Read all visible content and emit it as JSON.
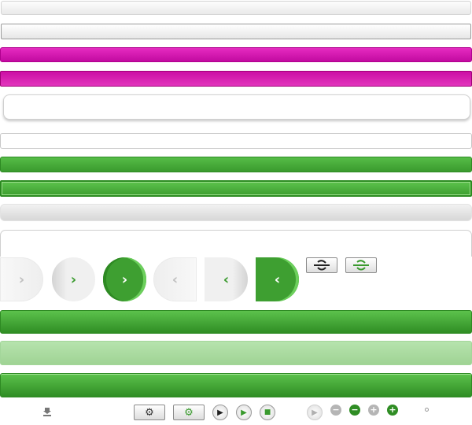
{
  "arrows": {
    "right": "›",
    "left": "‹"
  },
  "icons": {
    "gear": "⚙",
    "play": "▶",
    "stop": "■",
    "minus": "−",
    "plus": "+",
    "download": "download-icon",
    "link": "link-toggle-icon",
    "dot": "dot-icon"
  },
  "colors": {
    "magenta": "#cc0fa5",
    "green": "#3e9f31",
    "light_green": "#a6dc9b",
    "gray": "#d7d7d7"
  }
}
